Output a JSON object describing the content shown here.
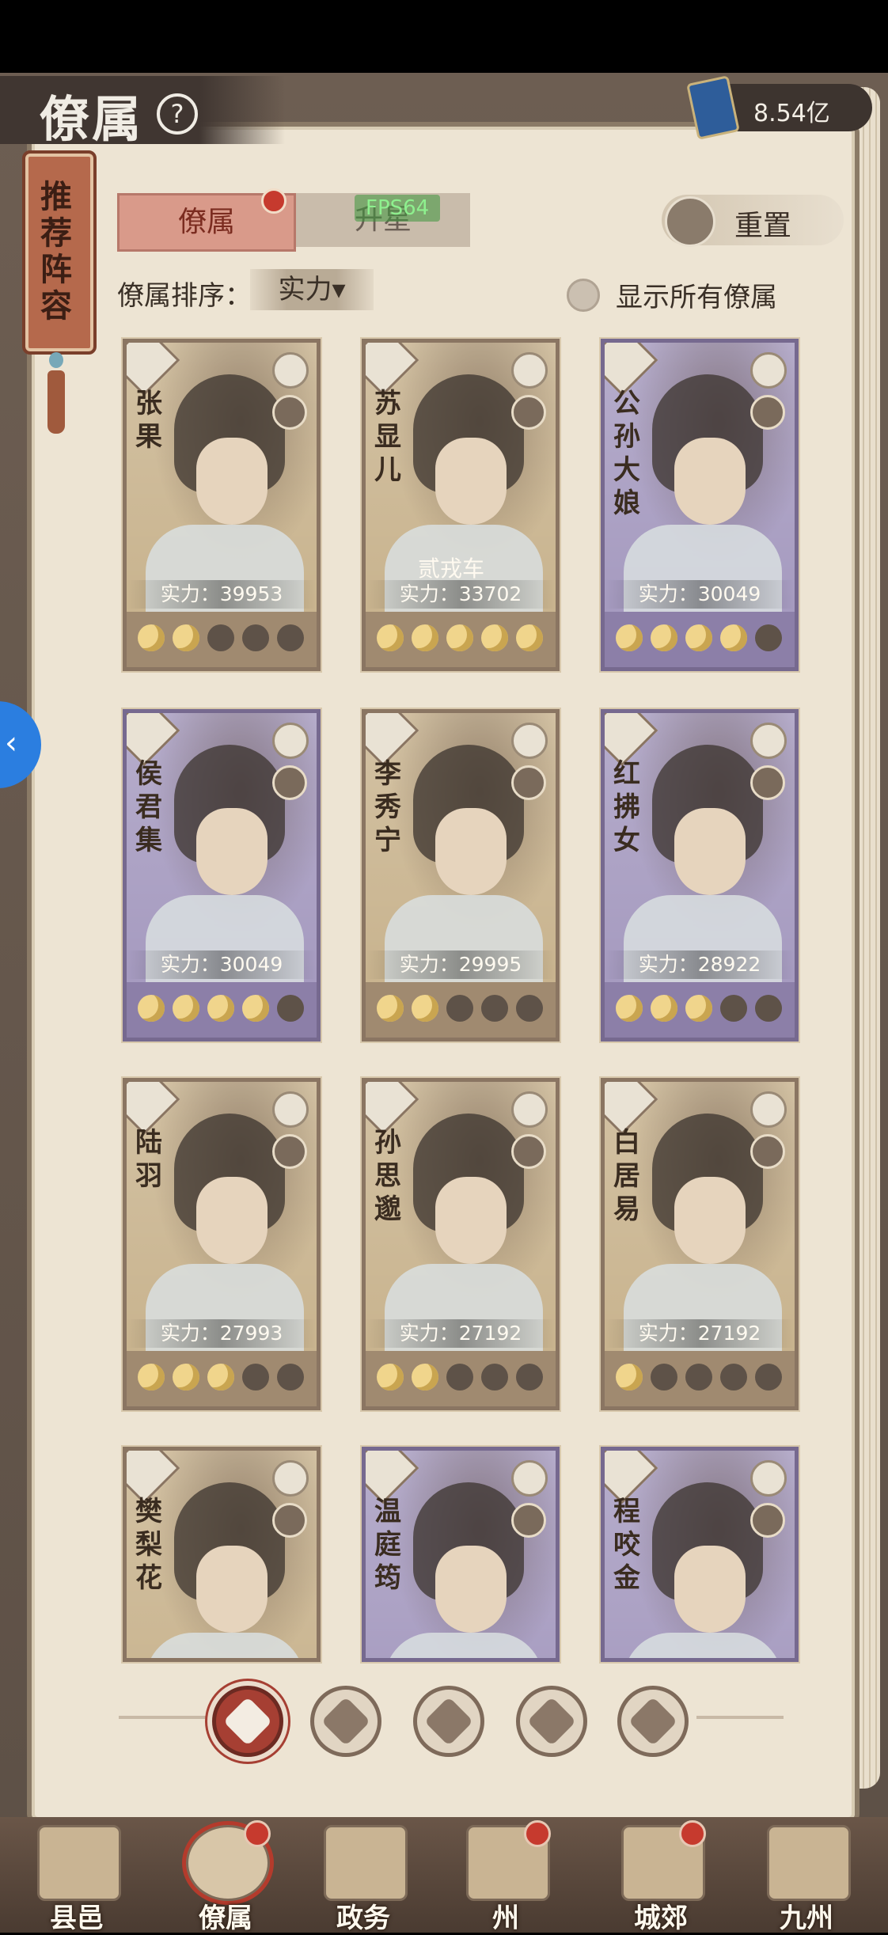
{
  "header": {
    "title": "僚属",
    "currency_value": "8.54亿"
  },
  "recommend_tab": "推荐阵容",
  "tabs": [
    {
      "label": "僚属",
      "active": true
    },
    {
      "label": "升星",
      "active": false
    }
  ],
  "fps_overlay": "FPS64",
  "reset_label": "重置",
  "sort": {
    "label": "僚属排序：",
    "selected": "实力"
  },
  "show_all_label": "显示所有僚属",
  "cards": [
    {
      "name": "张果",
      "power": "实力：39953",
      "stars": 2,
      "color": "tan"
    },
    {
      "name": "苏显儿",
      "power": "实力：33702",
      "stars": 5,
      "color": "tan"
    },
    {
      "name": "公孙大娘",
      "power": "实力：30049",
      "stars": 4,
      "color": "purple"
    },
    {
      "name": "侯君集",
      "power": "实力：30049",
      "stars": 4,
      "color": "purple"
    },
    {
      "name": "李秀宁",
      "power": "实力：29995",
      "stars": 2,
      "color": "tan"
    },
    {
      "name": "红拂女",
      "power": "实力：28922",
      "stars": 3,
      "color": "purple"
    },
    {
      "name": "陆羽",
      "power": "实力：27993",
      "stars": 3,
      "color": "tan"
    },
    {
      "name": "孙思邈",
      "power": "实力：27192",
      "stars": 2,
      "color": "tan"
    },
    {
      "name": "白居易",
      "power": "实力：27192",
      "stars": 1,
      "color": "tan"
    },
    {
      "name": "樊梨花",
      "power": "",
      "stars": 0,
      "color": "tan"
    },
    {
      "name": "温庭筠",
      "power": "",
      "stars": 0,
      "color": "purple"
    },
    {
      "name": "程咬金",
      "power": "",
      "stars": 0,
      "color": "purple"
    }
  ],
  "card_overlay_text": "贰戎车",
  "filters": [
    "all-icon",
    "gourd-icon",
    "gourd-calabash-icon",
    "fan-icon",
    "lion-icon"
  ],
  "bottom_nav": [
    {
      "label": "县邑",
      "badge": false
    },
    {
      "label": "僚属",
      "badge": true,
      "active": true
    },
    {
      "label": "政务",
      "badge": false
    },
    {
      "label": "州",
      "badge": true
    },
    {
      "label": "城郊",
      "badge": true
    },
    {
      "label": "九州",
      "badge": false
    }
  ]
}
